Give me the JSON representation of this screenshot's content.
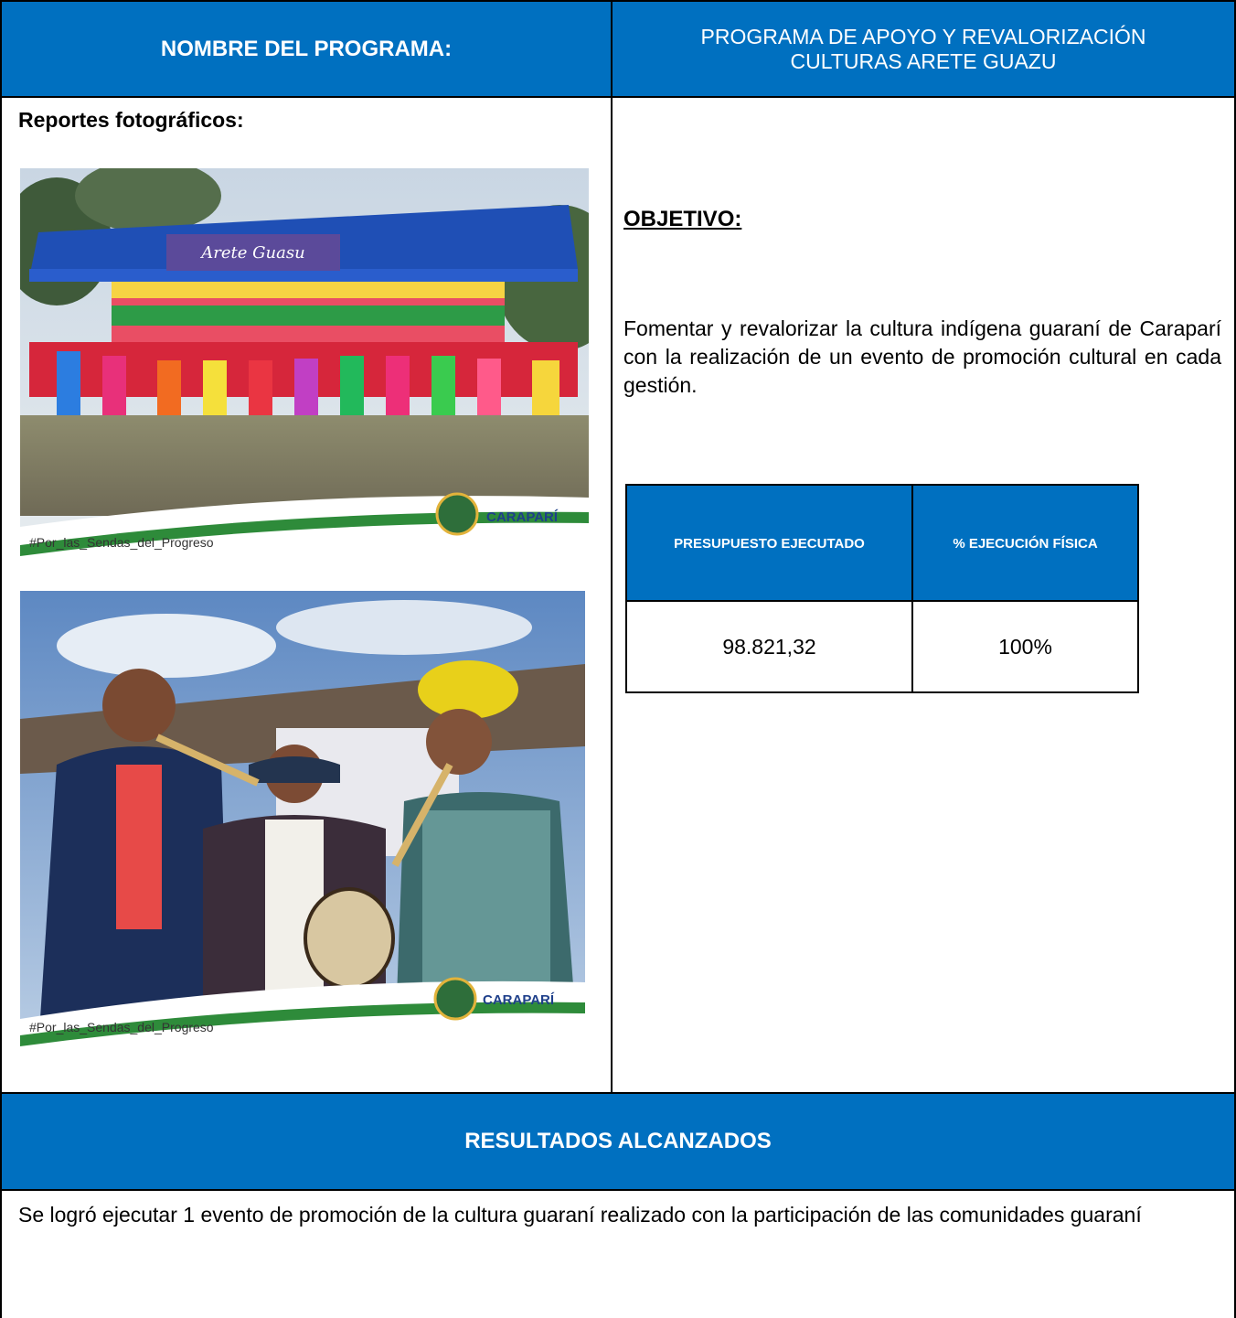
{
  "header": {
    "program_label": "NOMBRE DEL PROGRAMA:",
    "program_name": "PROGRAMA DE APOYO Y REVALORIZACIÓN CULTURAS ARETE GUAZU"
  },
  "photos": {
    "section_title": "Reportes fotográficos:",
    "hashtag": "#Por_las_Sendas_del_Progreso",
    "logo_text": "CARAPARÍ",
    "banner_text": "Arete Guasu"
  },
  "objective": {
    "heading": "OBJETIVO:",
    "text": "Fomentar y revalorizar la cultura indígena guaraní de Caraparí con la realización de un evento de promoción cultural en cada gestión."
  },
  "budget_table": {
    "headers": [
      "PRESUPUESTO EJECUTADO",
      "% EJECUCIÓN FÍSICA"
    ],
    "values": [
      "98.821,32",
      "100%"
    ]
  },
  "results": {
    "heading": "RESULTADOS ALCANZADOS",
    "text": "Se logró ejecutar 1 evento de promoción de la cultura guaraní realizado con la participación de las comunidades guaraní"
  },
  "colors": {
    "header_blue": "#0070c0"
  }
}
